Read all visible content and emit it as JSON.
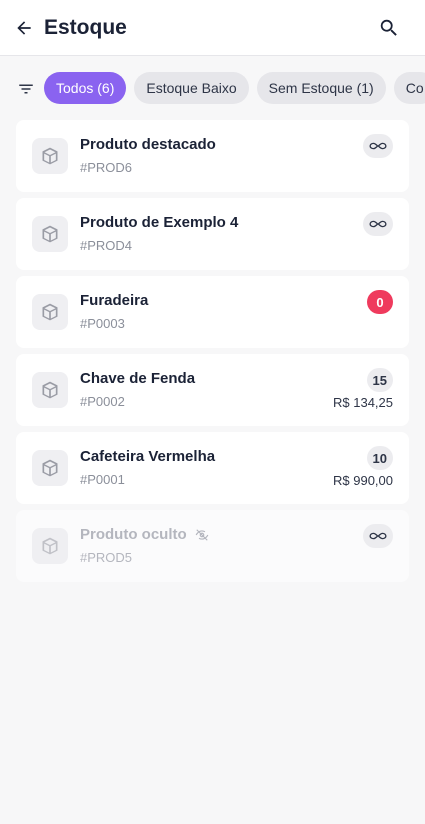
{
  "header": {
    "title": "Estoque",
    "back_icon": "arrow-left-icon",
    "search_icon": "search-icon"
  },
  "filters": {
    "filter_icon": "filter-list-icon",
    "chips": [
      {
        "label": "Todos (6)",
        "active": true
      },
      {
        "label": "Estoque Baixo",
        "active": false
      },
      {
        "label": "Sem Estoque (1)",
        "active": false
      },
      {
        "label": "Co",
        "active": false
      }
    ]
  },
  "products": [
    {
      "name": "Produto destacado",
      "sku": "#PROD6",
      "stock": "∞",
      "stock_icon": "infinity-icon",
      "price": ""
    },
    {
      "name": "Produto de Exemplo 4",
      "sku": "#PROD4",
      "stock": "∞",
      "stock_icon": "infinity-icon",
      "price": ""
    },
    {
      "name": "Furadeira",
      "sku": "#P0003",
      "stock": "0",
      "price": ""
    },
    {
      "name": "Chave de Fenda",
      "sku": "#P0002",
      "stock": "15",
      "price": "R$ 134,25"
    },
    {
      "name": "Cafeteira Vermelha",
      "sku": "#P0001",
      "stock": "10",
      "price": "R$ 990,00"
    },
    {
      "name": "Produto oculto",
      "sku": "#PROD5",
      "stock": "∞",
      "stock_icon": "infinity-icon",
      "price": "",
      "hidden": true,
      "hidden_icon": "eye-off-icon"
    }
  ],
  "colors": {
    "accent": "#8a63f0",
    "out_of_stock": "#ef3a5d",
    "background": "#f7f7f8"
  }
}
